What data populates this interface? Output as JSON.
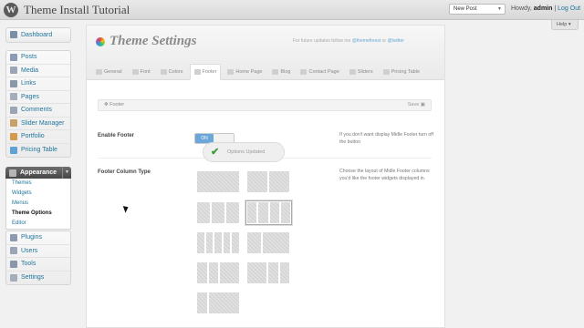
{
  "header": {
    "site_title": "Theme Install Tutorial",
    "new_post_label": "New Post",
    "howdy_prefix": "Howdy,",
    "username": "admin",
    "separator": "|",
    "logout_label": "Log Out",
    "help_label": "Help"
  },
  "sidebar": {
    "block1": [
      {
        "label": "Dashboard",
        "icon": "dashboard-icon"
      }
    ],
    "block2": [
      {
        "label": "Posts",
        "icon": "posts-icon"
      },
      {
        "label": "Media",
        "icon": "media-icon"
      },
      {
        "label": "Links",
        "icon": "links-icon"
      },
      {
        "label": "Pages",
        "icon": "pages-icon"
      },
      {
        "label": "Comments",
        "icon": "comments-icon"
      },
      {
        "label": "Slider Manager",
        "icon": "slider-icon"
      },
      {
        "label": "Portfolio",
        "icon": "portfolio-icon"
      },
      {
        "label": "Pricing Table",
        "icon": "pricing-icon"
      }
    ],
    "appearance_label": "Appearance",
    "appearance_sub": [
      "Themes",
      "Widgets",
      "Menus",
      "Theme Options",
      "Editor"
    ],
    "block3": [
      {
        "label": "Plugins",
        "icon": "plugins-icon"
      },
      {
        "label": "Users",
        "icon": "users-icon"
      },
      {
        "label": "Tools",
        "icon": "tools-icon"
      },
      {
        "label": "Settings",
        "icon": "settings-icon"
      }
    ]
  },
  "panel": {
    "title": "Theme Settings",
    "follow_text": "For future updates follow me",
    "follow_handle": "@themeforest",
    "follow_or": "or",
    "follow_twitter": "@twitter",
    "tabs": [
      "General",
      "Font",
      "Colors",
      "Footer",
      "Home Page",
      "Blog",
      "Contact Page",
      "Sliders",
      "Pricing Table"
    ],
    "active_tab": "Footer",
    "section_title": "Footer",
    "save_label": "Save",
    "enable_footer": {
      "label": "Enable Footer",
      "toggle_on": "ON",
      "description": "If you don't want display Midle Footer turn off the button"
    },
    "toast_text": "Options Updated",
    "footer_columns": {
      "label": "Footer Column Type",
      "description": "Choose the layout of Midle Footer columns you'd like the footer widgets displayed in.",
      "selected_index": 3
    }
  },
  "colors": {
    "link": "#21759b",
    "appearance_bg": "#464646",
    "toggle_on": "#6da7d9",
    "check": "#3a9d3a"
  }
}
